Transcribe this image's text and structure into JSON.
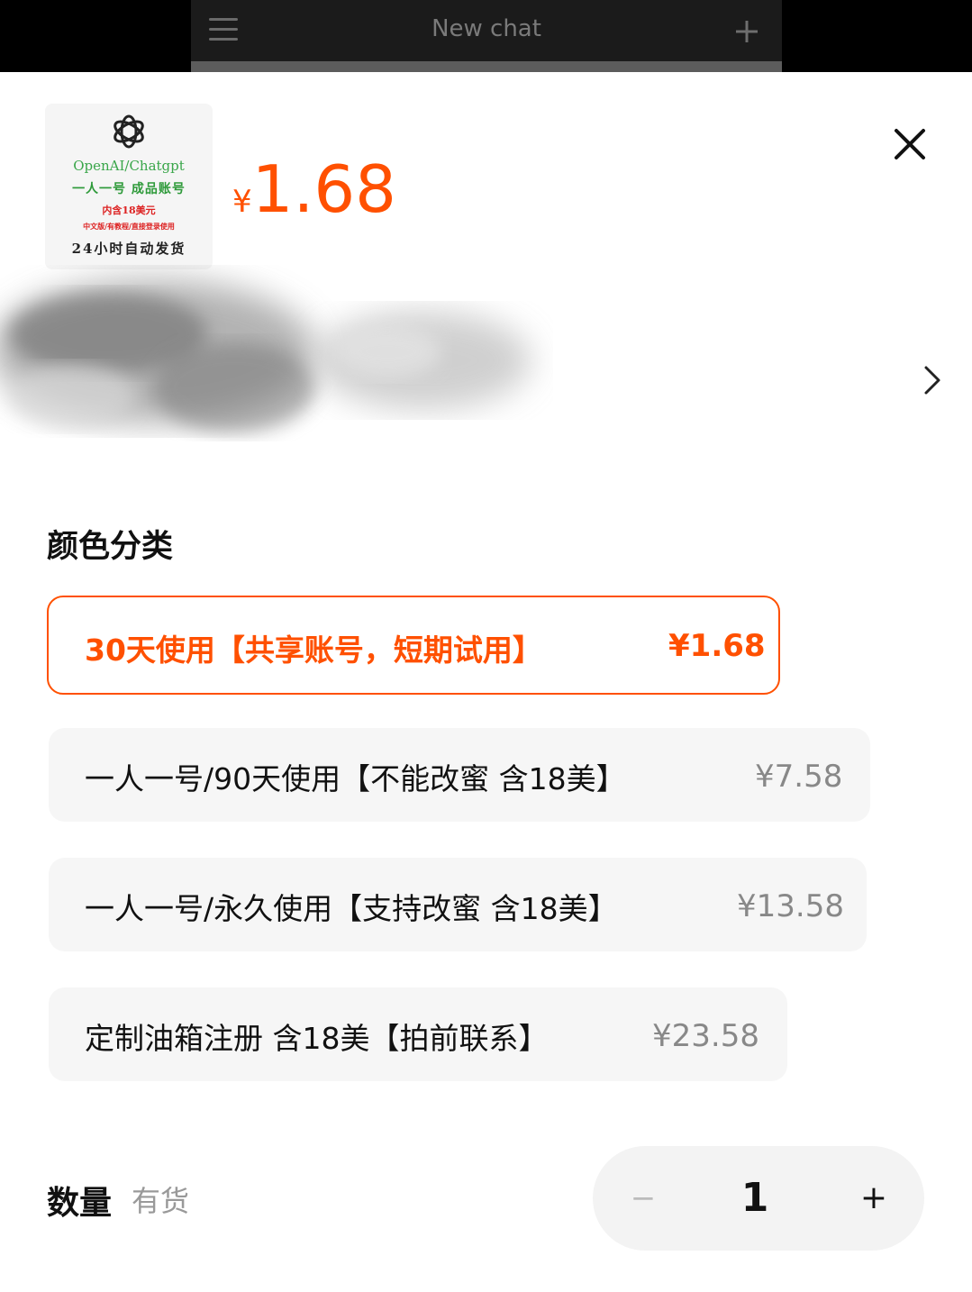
{
  "top_bar": {
    "title": "New chat",
    "menu_icon": "menu-icon",
    "new_chat_icon": "plus-icon"
  },
  "product": {
    "thumbnail": {
      "line1": "OpenAI/Chatgpt",
      "line2": "一人一号 成品账号",
      "line3": "内含18美元",
      "line4": "中文版/有教程/直接登录使用",
      "line5": "24小时自动发货"
    },
    "price_symbol": "¥",
    "price": "1.68",
    "accent_color": "#ff5000"
  },
  "section_title": "颜色分类",
  "options": [
    {
      "label": "30天使用【共享账号，短期试用】",
      "price": "¥1.68",
      "selected": true
    },
    {
      "label": "一人一号/90天使用【不能改蜜 含18美】",
      "price": "¥7.58",
      "selected": false
    },
    {
      "label": "一人一号/永久使用【支持改蜜 含18美】",
      "price": "¥13.58",
      "selected": false
    },
    {
      "label": "定制油箱注册 含18美【拍前联系】",
      "price": "¥23.58",
      "selected": false
    }
  ],
  "quantity": {
    "label": "数量",
    "stock": "有货",
    "minus": "−",
    "value": "1",
    "plus": "+"
  }
}
